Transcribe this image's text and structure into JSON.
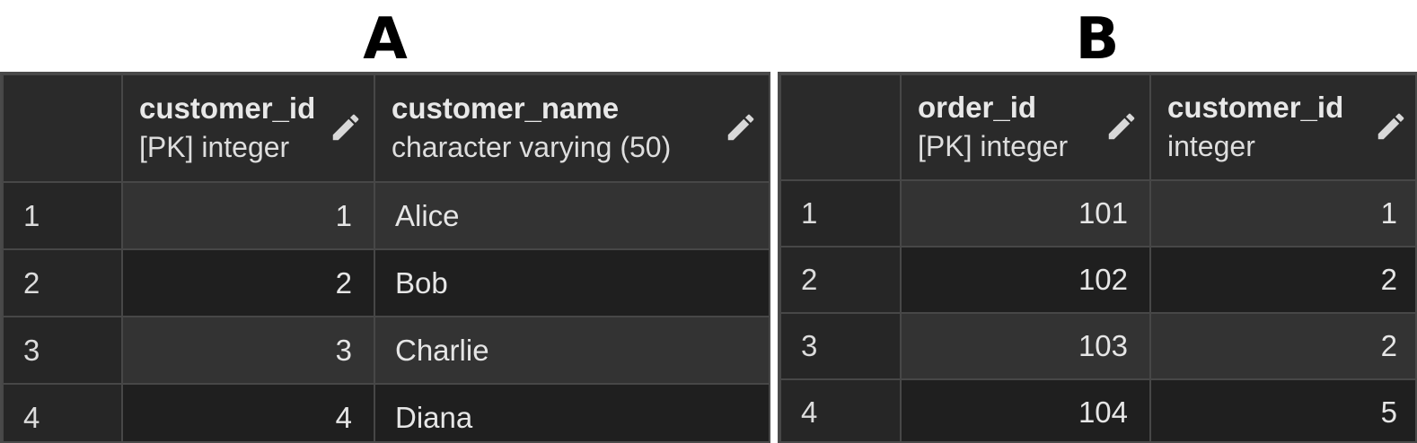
{
  "panels": {
    "a": {
      "label": "A",
      "columns": [
        {
          "name": "customer_id",
          "type": "[PK] integer"
        },
        {
          "name": "customer_name",
          "type": "character varying (50)"
        }
      ],
      "rows": [
        {
          "row": "1",
          "c1": "1",
          "c2": "Alice"
        },
        {
          "row": "2",
          "c1": "2",
          "c2": "Bob"
        },
        {
          "row": "3",
          "c1": "3",
          "c2": "Charlie"
        },
        {
          "row": "4",
          "c1": "4",
          "c2": "Diana"
        }
      ]
    },
    "b": {
      "label": "B",
      "columns": [
        {
          "name": "order_id",
          "type": "[PK] integer"
        },
        {
          "name": "customer_id",
          "type": "integer"
        }
      ],
      "rows": [
        {
          "row": "1",
          "c1": "101",
          "c2": "1"
        },
        {
          "row": "2",
          "c1": "102",
          "c2": "2"
        },
        {
          "row": "3",
          "c1": "103",
          "c2": "2"
        },
        {
          "row": "4",
          "c1": "104",
          "c2": "5"
        }
      ]
    }
  },
  "icons": {
    "edit": "pencil-icon"
  },
  "colors": {
    "grid_background": "#3b3b3b",
    "header_background": "#2a2a2a",
    "row_light": "#333333",
    "row_dark": "#1f1f1f",
    "text": "#e6e6e6"
  }
}
